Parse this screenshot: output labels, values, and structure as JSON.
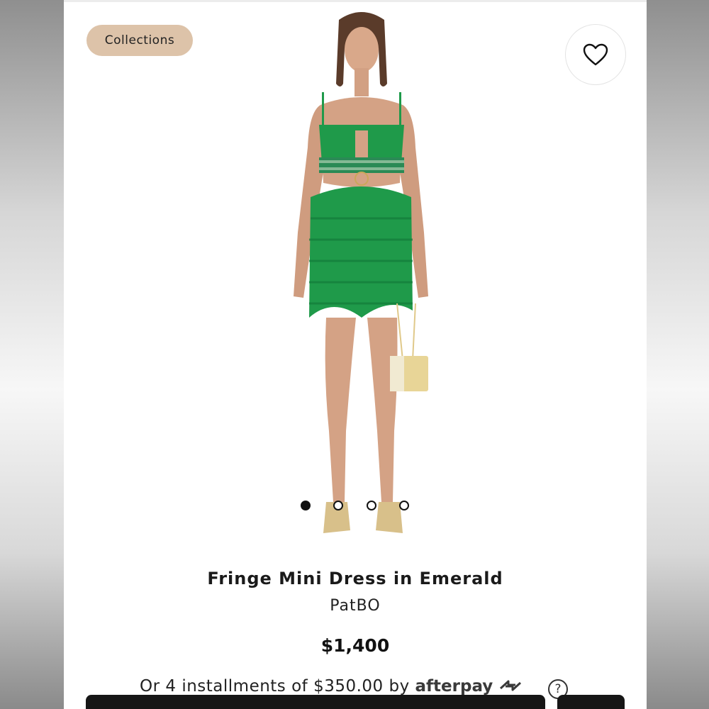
{
  "header": {
    "collections_label": "Collections",
    "favorite_icon": "heart-icon"
  },
  "gallery": {
    "image_count": 4,
    "active_index": 0
  },
  "product": {
    "name": "Fringe Mini Dress in Emerald",
    "brand": "PatBO",
    "price": "$1,400"
  },
  "payment": {
    "installments_text": "Or 4 installments of $350.00 by",
    "provider": "afterpay",
    "help_symbol": "?"
  },
  "colors": {
    "chip_bg": "#ddc3a9",
    "dress_green": "#1f9a4a",
    "text_dark": "#1a1a1a"
  }
}
